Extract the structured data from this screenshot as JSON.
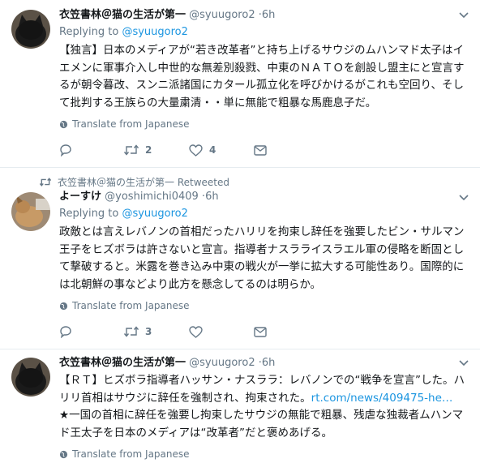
{
  "tweets": [
    {
      "author_name": "衣笠書林＠猫の生活が第一",
      "handle": "@syuugoro2",
      "time": "6h",
      "replying_label": "Replying to",
      "replying_to": "@syuugoro2",
      "text": "【独言】日本のメディアが“若き改革者”と持ち上げるサウジのムハンマド太子はイエメンに軍事介入し中世的な無差別殺戮、中東のＮＡＴＯを創設し盟主にと宣言するが朝令暮改、スンニ派諸国にカタール孤立化を呼びかけるがこれも空回り、そして批判する王族らの大量粛清・・単に無能で粗暴な馬鹿息子だ。",
      "translate": "Translate from Japanese",
      "retweets": "2",
      "likes": "4"
    },
    {
      "retweeted_by": "衣笠書林＠猫の生活が第一 Retweeted",
      "author_name": "よーすけ",
      "handle": "@yoshimichi0409",
      "time": "6h",
      "replying_label": "Replying to",
      "replying_to": "@syuugoro2",
      "text": "政敵とは言えレバノンの首相だったハリリを拘束し辞任を強要したビン・サルマン王子をヒズボラは許さないと宣言。指導者ナスラライスラエル軍の侵略を断固として撃破すると。米露を巻き込み中東の戦火が一挙に拡大する可能性あり。国際的には北朝鮮の事などより此方を懸念してるのは明らか。",
      "translate": "Translate from Japanese",
      "retweets": "3",
      "likes": ""
    },
    {
      "author_name": "衣笠書林＠猫の生活が第一",
      "handle": "@syuugoro2",
      "time": "6h",
      "text_before_link": "【ＲＴ】ヒズボラ指導者ハッサン・ナスララ：レバノンでの“戦争を宣言”した。ハリリ首相はサウジに辞任を強制され、拘束された。",
      "link": "rt.com/news/409475-he…",
      "text_after_link": "★一国の首相に辞任を強要し拘束したサウジの無能で粗暴、残虐な独裁者ムハンマド王太子を日本のメディアは“改革者”だと褒めあげる。",
      "translate": "Translate from Japanese"
    }
  ],
  "colors": {
    "link": "#1b95e0",
    "muted": "#657786",
    "border": "#e6ecf0"
  }
}
